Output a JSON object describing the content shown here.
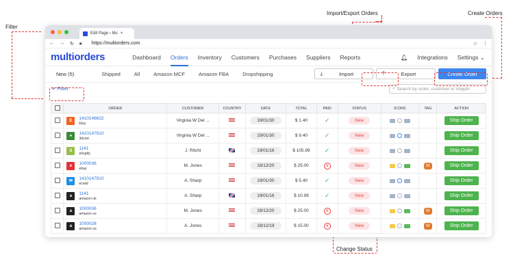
{
  "annotations": {
    "filter": "Filter",
    "import_export": "Import/Export Orders",
    "create": "Create Orders",
    "change_status": "Change Status"
  },
  "browser": {
    "tab_title": "Edit Page ‹ Mu",
    "url": "https://multiorders.com"
  },
  "nav": {
    "logo": "multiorders",
    "items": [
      "Dashboard",
      "Orders",
      "Inventory",
      "Customers",
      "Purchases",
      "Suppliers",
      "Reports"
    ],
    "active": "Orders",
    "right": [
      "Integrations",
      "Settings"
    ]
  },
  "subnav": {
    "tabs": [
      "New (5)",
      "Shipped",
      "All",
      "Amazon MCF",
      "Amazon FBA",
      "Dropshipping"
    ]
  },
  "buttons": {
    "import": "Import",
    "export": "Export",
    "create": "Create Order"
  },
  "filter": {
    "label": "Filter"
  },
  "search": {
    "placeholder": "Search by order, customer or shippin"
  },
  "table": {
    "headers": [
      "ORDER",
      "CUSTOMER",
      "COUNTRY",
      "DATE",
      "TOTAL",
      "PAID",
      "STATUS",
      "ICONS",
      "TAG",
      "ACTION"
    ],
    "rows": [
      {
        "id": "1410148632",
        "store": "Etsy",
        "customer": "Virginia W Del ...",
        "country": "us",
        "date": "19/01/30",
        "total": "$ 1.40",
        "paid": true,
        "status": "New",
        "tag": "",
        "action": "Ship Order"
      },
      {
        "id": "1410147910",
        "store": "3dcart",
        "customer": "Virginia W Del ...",
        "country": "us",
        "date": "19/01/30",
        "total": "$ 9.40",
        "paid": true,
        "status": "New",
        "tag": "",
        "action": "Ship Order"
      },
      {
        "id": "1141",
        "store": "shopify",
        "customer": "J. Ritchi",
        "country": "uk",
        "date": "19/01/16",
        "total": "$ 105.99",
        "paid": true,
        "status": "New",
        "tag": "",
        "action": "Ship Order"
      },
      {
        "id": "1000036",
        "store": "ebay",
        "customer": "M. Jones",
        "country": "us",
        "date": "18/12/20",
        "total": "$ 25.00",
        "paid": false,
        "status": "New",
        "tag": "M",
        "action": "Ship Order"
      },
      {
        "id": "1410147910",
        "store": "ecwid",
        "customer": "A. Sharp",
        "country": "us",
        "date": "19/01/30",
        "total": "$ 5.40",
        "paid": true,
        "status": "New",
        "tag": "",
        "action": "Ship Order"
      },
      {
        "id": "1141",
        "store": "amazon uk",
        "customer": "A. Sharp",
        "country": "uk",
        "date": "19/01/16",
        "total": "$ 10.99",
        "paid": true,
        "status": "New",
        "tag": "",
        "action": "Ship Order"
      },
      {
        "id": "1000036",
        "store": "amazon us",
        "customer": "M. Jones",
        "country": "us",
        "date": "18/12/20",
        "total": "$ 25.00",
        "paid": false,
        "status": "New",
        "tag": "M",
        "action": "Ship Order"
      },
      {
        "id": "1000028",
        "store": "amazon us",
        "customer": "A. Jones",
        "country": "us",
        "date": "18/12/19",
        "total": "$ 15.00",
        "paid": false,
        "status": "New",
        "tag": "M",
        "action": "Ship Order"
      }
    ]
  },
  "colors": {
    "accent": "#3d86f0",
    "ship": "#4db34d",
    "annotation": "#dd3333"
  }
}
